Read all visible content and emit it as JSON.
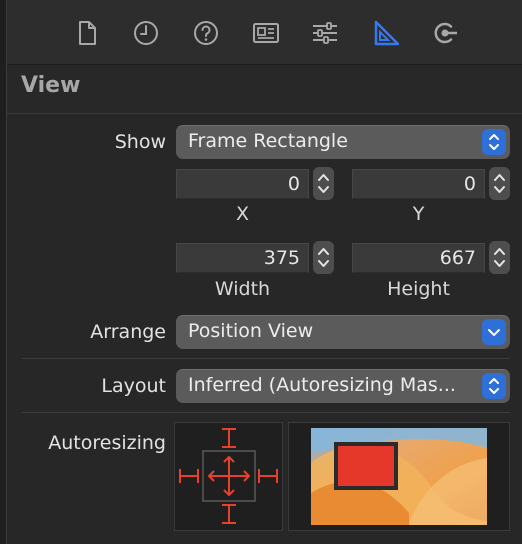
{
  "toolbar": {
    "icons": [
      "file-icon",
      "history-icon",
      "help-icon",
      "identity-icon",
      "attributes-icon",
      "size-icon",
      "connections-icon"
    ],
    "accent": "#3478f6"
  },
  "section": {
    "title": "View"
  },
  "show": {
    "label": "Show",
    "value": "Frame Rectangle"
  },
  "frame": {
    "x": {
      "value": "0",
      "caption": "X"
    },
    "y": {
      "value": "0",
      "caption": "Y"
    },
    "width": {
      "value": "375",
      "caption": "Width"
    },
    "height": {
      "value": "667",
      "caption": "Height"
    }
  },
  "arrange": {
    "label": "Arrange",
    "value": "Position View"
  },
  "layout": {
    "label": "Layout",
    "value": "Inferred (Autoresizing Mas..."
  },
  "autoresizing": {
    "label": "Autoresizing",
    "strut_color": "#e6412d"
  }
}
